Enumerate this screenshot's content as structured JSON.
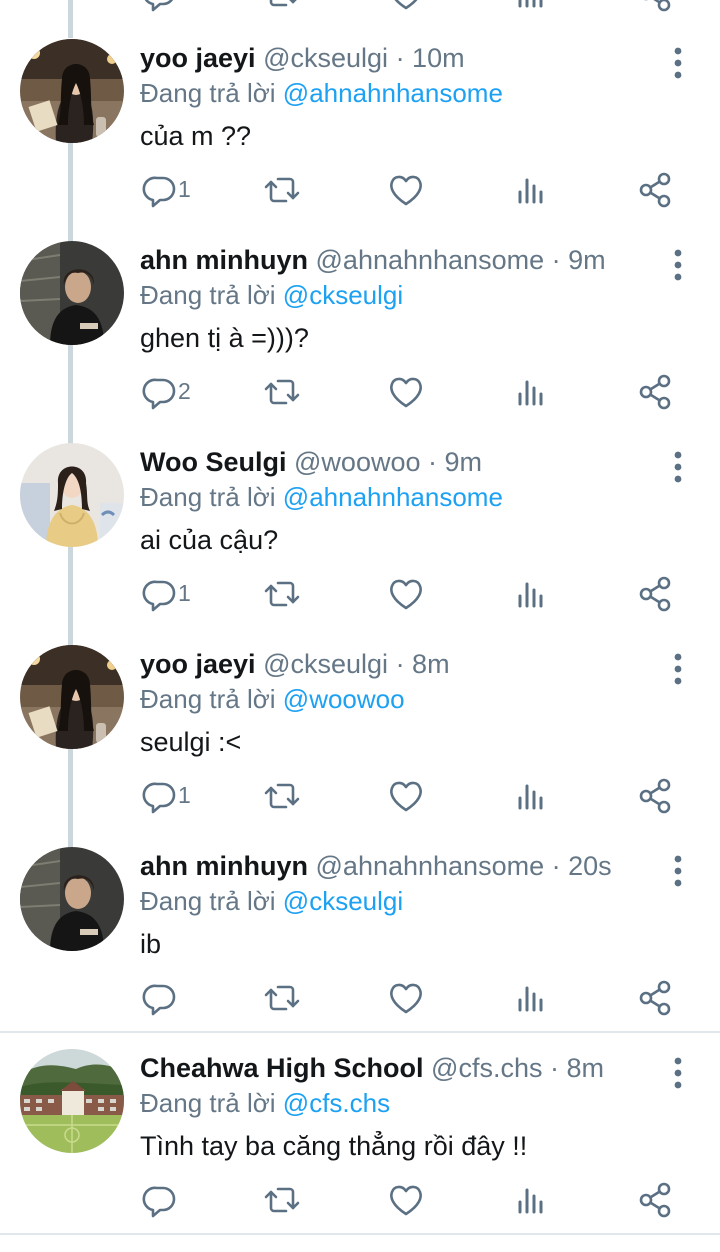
{
  "tweets": [
    {
      "name": "yoo jaeyi",
      "handle": "@ckseulgi",
      "time": "· 10m",
      "reply_label": "Đang trả lời",
      "reply_to": "@ahnahnhansome",
      "text": "của m ??",
      "reply_count": "1",
      "avatar": "woman-dark-hair-cafe"
    },
    {
      "name": "ahn minhuyn",
      "handle": "@ahnahnhansome",
      "time": "· 9m",
      "reply_label": "Đang trả lời",
      "reply_to": "@ckseulgi",
      "text": "ghen tị à =)))?",
      "reply_count": "2",
      "avatar": "man-dark-portrait"
    },
    {
      "name": "Woo Seulgi",
      "handle": "@woowoo",
      "time": "· 9m",
      "reply_label": "Đang trả lời",
      "reply_to": "@ahnahnhansome",
      "text": "ai của cậu?",
      "reply_count": "1",
      "avatar": "woman-yellow-sweater"
    },
    {
      "name": "yoo jaeyi",
      "handle": "@ckseulgi",
      "time": "· 8m",
      "reply_label": "Đang trả lời",
      "reply_to": "@woowoo",
      "text": "seulgi :<",
      "reply_count": "1",
      "avatar": "woman-dark-hair-cafe"
    },
    {
      "name": "ahn minhuyn",
      "handle": "@ahnahnhansome",
      "time": "· 20s",
      "reply_label": "Đang trả lời",
      "reply_to": "@ckseulgi",
      "text": "ib",
      "reply_count": "",
      "avatar": "man-dark-portrait"
    },
    {
      "name": "Cheahwa High School",
      "handle": "@cfs.chs",
      "time": "· 8m",
      "reply_label": "Đang trả lời",
      "reply_to": "@cfs.chs",
      "text": "Tình tay ba căng thẳng rồi đây !!",
      "reply_count": "",
      "avatar": "school-building-field"
    }
  ],
  "icons": {
    "reply": "reply-icon",
    "retweet": "retweet-icon",
    "like": "like-icon",
    "analytics": "analytics-icon",
    "share": "share-icon",
    "more": "more-options-icon"
  },
  "colors": {
    "text": "#14171a",
    "secondary": "#657786",
    "accent": "#1da1f2",
    "icon": "#5b7083",
    "thread_line": "#ccd6dd",
    "divider": "#e1e8ed"
  }
}
